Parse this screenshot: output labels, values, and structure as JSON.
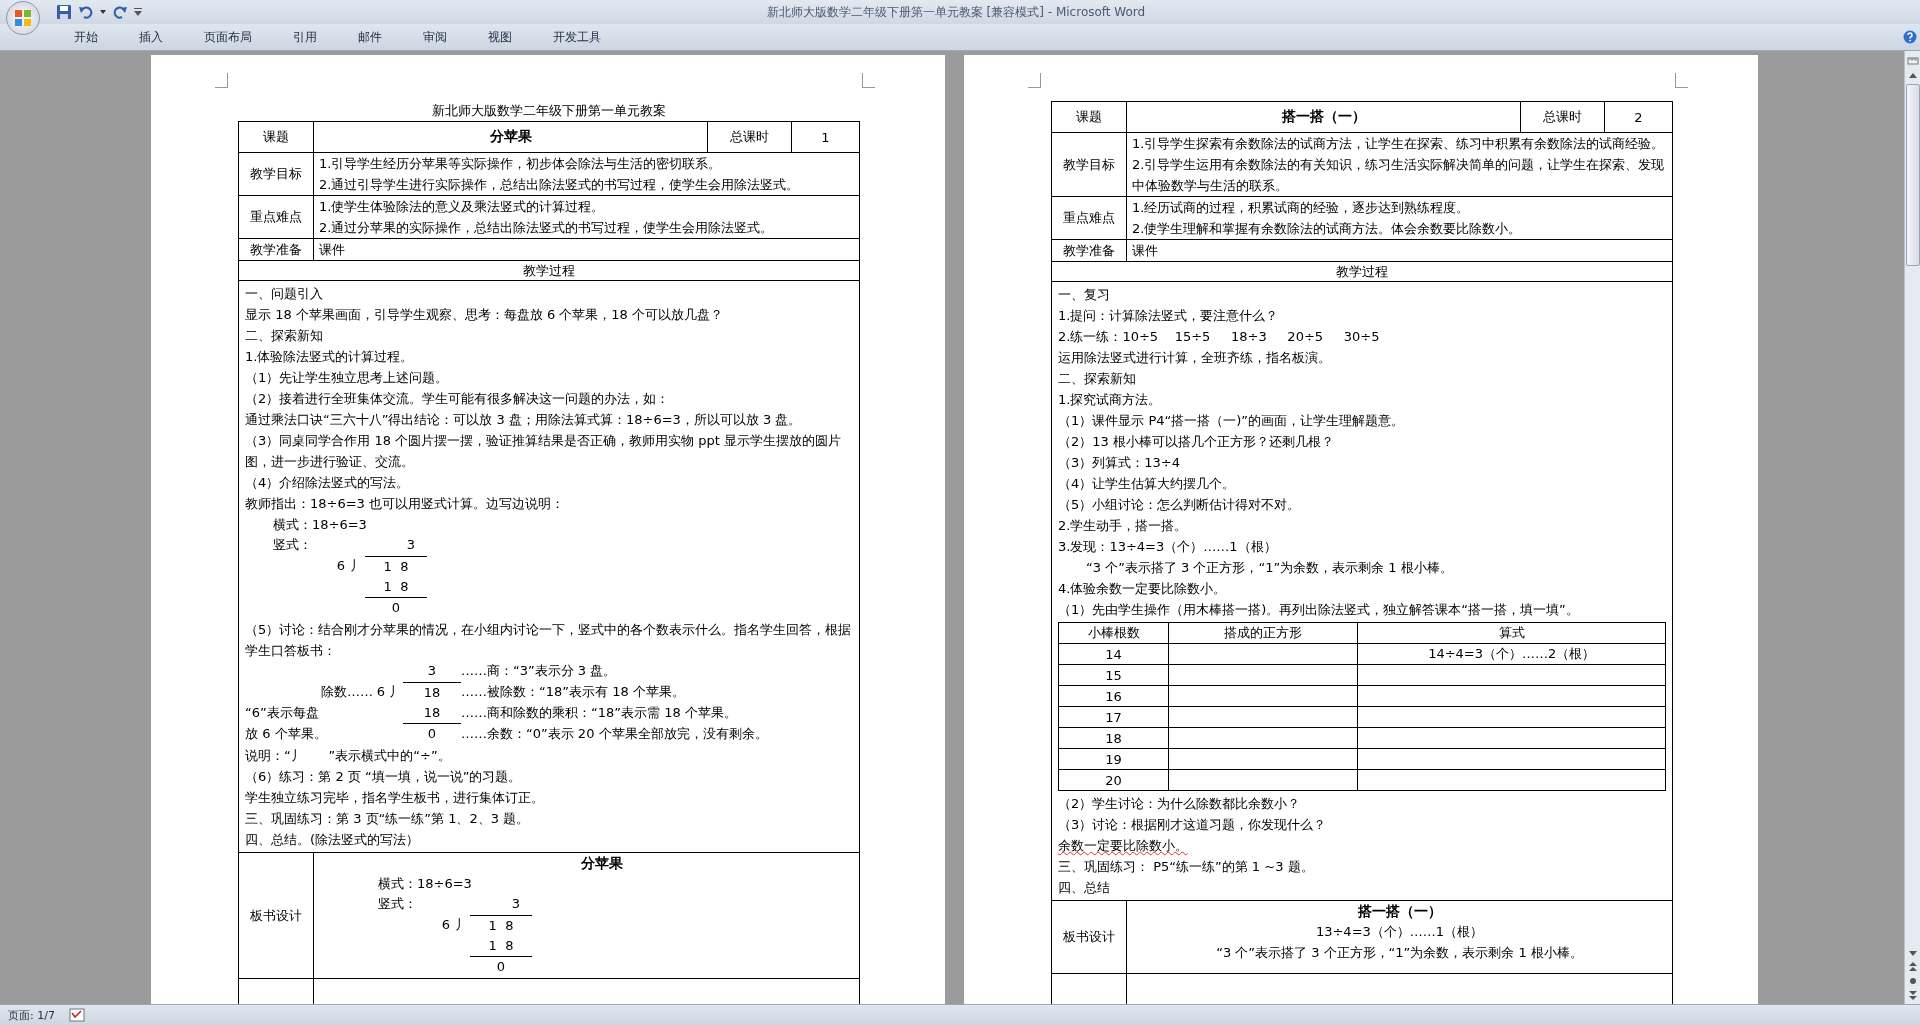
{
  "window": {
    "title": "新北师大版数学二年级下册第一单元教案 [兼容模式] - Microsoft Word"
  },
  "ribbon_tabs": [
    "开始",
    "插入",
    "页面布局",
    "引用",
    "邮件",
    "审阅",
    "视图",
    "开发工具"
  ],
  "pages": [
    {
      "heading": "新北师大版数学二年级下册第一单元教案",
      "topic_label": "课题",
      "topic": "分苹果",
      "hours_label": "总课时",
      "hours": "1",
      "goals_label": "教学目标",
      "goals": [
        "1.引导学生经历分苹果等实际操作，初步体会除法与生活的密切联系。",
        "2.通过引导学生进行实际操作，总结出除法竖式的书写过程，使学生会用除法竖式。"
      ],
      "focus_label": "重点难点",
      "focus": [
        "1.使学生体验除法的意义及乘法竖式的计算过程。",
        "2.通过分苹果的实际操作，总结出除法竖式的书写过程，使学生会用除法竖式。"
      ],
      "prep_label": "教学准备",
      "prep": "课件",
      "process_label": "教学过程",
      "process": [
        {
          "kind": "line",
          "text": "一、问题引入"
        },
        {
          "kind": "line",
          "text": "显示 18 个苹果画面，引导学生观察、思考：每盘放 6 个苹果，18 个可以放几盘？"
        },
        {
          "kind": "line",
          "text": "二、探索新知"
        },
        {
          "kind": "line",
          "text": "1.体验除法竖式的计算过程。"
        },
        {
          "kind": "line",
          "text": "（1）先让学生独立思考上述问题。"
        },
        {
          "kind": "line",
          "text": "（2）接着进行全班集体交流。学生可能有很多解决这一问题的办法，如："
        },
        {
          "kind": "line",
          "text": "通过乘法口诀“三六十八”得出结论：可以放 3 盘；用除法算式算：18÷6=3，所以可以放 3 盘。"
        },
        {
          "kind": "line",
          "text": "（3）同桌同学合作用 18 个圆片摆一摆，验证推算结果是否正确，教师用实物 ppt 显示学生摆放的圆片图，进一步进行验证、交流。"
        },
        {
          "kind": "line",
          "text": "（4）介绍除法竖式的写法。"
        },
        {
          "kind": "line",
          "text": "教师指出：18÷6=3 也可以用竖式计算。边写边说明："
        },
        {
          "kind": "indented",
          "text": "横式：18÷6=3"
        },
        {
          "kind": "division",
          "label": "竖式：",
          "quotient": "3",
          "divisor": "6",
          "bracket": "丿",
          "dividend": "1  8",
          "product": "1  8",
          "remainder": "0"
        },
        {
          "kind": "line",
          "text": "（5）讨论：结合刚才分苹果的情况，在小组内讨论一下，竖式中的各个数表示什么。指名学生回答，根据学生口答板书："
        },
        {
          "kind": "annotated",
          "quotient": "3",
          "quotient_note": "……商：“3”表示分 3 盘。",
          "divisor_label": "除数……",
          "divisor": "6",
          "bracket": "丿",
          "dividend": "18",
          "dividend_note": "……被除数：“18”表示有 18 个苹果。",
          "left_note": "“6”表示每盘",
          "product": "18",
          "product_note": "……商和除数的乘积：“18”表示需 18 个苹果。",
          "left_note_2": "放 6 个苹果。",
          "remainder": "0",
          "remainder_note": "……余数：“0”表示 20 个苹果全部放完，没有剩余。"
        },
        {
          "kind": "line",
          "text": "说明：“丿      ”表示横式中的“÷”。"
        },
        {
          "kind": "line",
          "text": "（6）练习：第 2 页 “填一填，说一说”的习题。"
        },
        {
          "kind": "line",
          "text": "学生独立练习完毕，指名学生板书，进行集体订正。"
        },
        {
          "kind": "line",
          "text": "三、巩固练习：第 3 页“练一练”第 1、2、3 题。"
        },
        {
          "kind": "line",
          "text": "四、总结。(除法竖式的写法）"
        }
      ],
      "board_label": "板书设计",
      "board_title": "分苹果",
      "board": [
        {
          "kind": "indented",
          "text": "横式：18÷6=3"
        },
        {
          "kind": "division",
          "label": "竖式：",
          "quotient": "3",
          "divisor": "6",
          "bracket": "丿",
          "dividend": "1  8",
          "product": "1  8",
          "remainder": "0"
        }
      ]
    },
    {
      "topic_label": "课题",
      "topic": "搭一搭（一）",
      "hours_label": "总课时",
      "hours": "2",
      "goals_label": "教学目标",
      "goals": [
        "1.引导学生探索有余数除法的试商方法，让学生在探索、练习中积累有余数除法的试商经验。",
        "2.引导学生运用有余数除法的有关知识，练习生活实际解决简单的问题，让学生在探索、发现中体验数学与生活的联系。"
      ],
      "focus_label": "重点难点",
      "focus": [
        "1.经历试商的过程，积累试商的经验，逐步达到熟练程度。",
        "2.使学生理解和掌握有余数除法的试商方法。体会余数要比除数小。"
      ],
      "prep_label": "教学准备",
      "prep": "课件",
      "process_label": "教学过程",
      "process": [
        {
          "kind": "line",
          "text": "一、复习"
        },
        {
          "kind": "line",
          "text": "1.提问：计算除法竖式，要注意什么？"
        },
        {
          "kind": "line",
          "text": "2.练一练：10÷5    15÷5     18÷3     20÷5     30÷5"
        },
        {
          "kind": "line",
          "text": "运用除法竖式进行计算，全班齐练，指名板演。"
        },
        {
          "kind": "line",
          "text": "二、探索新知"
        },
        {
          "kind": "line",
          "text": "1.探究试商方法。"
        },
        {
          "kind": "line",
          "text": "（1）课件显示 P4“搭一搭（一)”的画面，让学生理解题意。"
        },
        {
          "kind": "line",
          "text": "（2）13 根小棒可以搭几个正方形？还剩几根？"
        },
        {
          "kind": "line",
          "text": "（3）列算式：13÷4"
        },
        {
          "kind": "line",
          "text": "（4）让学生估算大约摆几个。"
        },
        {
          "kind": "line",
          "text": "（5）小组讨论：怎么判断估计得对不对。"
        },
        {
          "kind": "line",
          "text": "2.学生动手，搭一搭。"
        },
        {
          "kind": "line",
          "text": "3.发现：13÷4=3（个）……1（根）"
        },
        {
          "kind": "indented",
          "text": "“3 个”表示搭了 3 个正方形，“1”为余数，表示剩余 1 根小棒。"
        },
        {
          "kind": "line",
          "text": "4.体验余数一定要比除数小。"
        },
        {
          "kind": "line",
          "text": "（1）先由学生操作（用木棒搭一搭)。再列出除法竖式，独立解答课本“搭一搭，填一填”。"
        },
        {
          "kind": "grid",
          "columns": [
            "小棒根数",
            "搭成的正方形",
            "算式"
          ],
          "rows": [
            {
              "count": "14",
              "formula": "14÷4=3（个）……2（根）"
            },
            {
              "count": "15"
            },
            {
              "count": "16"
            },
            {
              "count": "17"
            },
            {
              "count": "18"
            },
            {
              "count": "19"
            },
            {
              "count": "20"
            }
          ]
        },
        {
          "kind": "line",
          "text": "（2）学生讨论：为什么除数都比余数小？"
        },
        {
          "kind": "line",
          "text": "（3）讨论：根据刚才这道习题，你发现什么？"
        },
        {
          "kind": "flagged",
          "text": "余数一定要比除数小。"
        },
        {
          "kind": "line",
          "text": "三、巩固练习： P5“练一练”的第 1 ~3 题。"
        },
        {
          "kind": "line",
          "text": "四、总结"
        }
      ],
      "board_label": "板书设计",
      "board_title": "搭一搭（一）",
      "board": [
        {
          "kind": "centered",
          "text": "13÷4=3（个）……1（根）"
        },
        {
          "kind": "centered",
          "text": "“3 个”表示搭了 3 个正方形，“1”为余数，表示剩余 1 根小棒。"
        }
      ]
    }
  ],
  "status_bar": {
    "page": "页面: 1/7"
  }
}
